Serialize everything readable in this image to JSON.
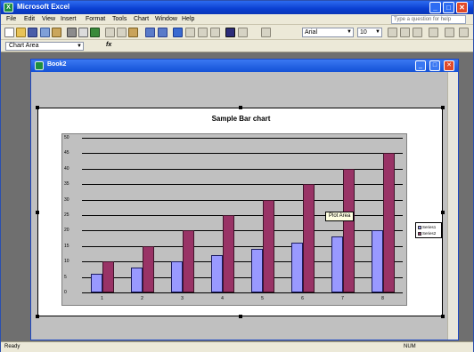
{
  "app": {
    "title": "Microsoft Excel",
    "buttons": {
      "minimize": "_",
      "maximize": "□",
      "close": "✕"
    }
  },
  "menubar": {
    "items": [
      "File",
      "Edit",
      "View",
      "Insert",
      "Format",
      "Tools",
      "Chart",
      "Window",
      "Help"
    ],
    "help_placeholder": "Type a question for help"
  },
  "toolbar": {
    "font": "Arial",
    "size": "10"
  },
  "formula": {
    "namebox": "Chart Area",
    "fx": "fx"
  },
  "workbook": {
    "title": "Book2"
  },
  "chart_data": {
    "type": "bar",
    "title": "Sample Bar chart",
    "categories": [
      "1",
      "2",
      "3",
      "4",
      "5",
      "6",
      "7",
      "8"
    ],
    "series": [
      {
        "name": "Series1",
        "values": [
          6,
          8,
          10,
          12,
          14,
          16,
          18,
          20
        ],
        "color": "#9999ff"
      },
      {
        "name": "Series2",
        "values": [
          10,
          15,
          20,
          25,
          30,
          35,
          40,
          45
        ],
        "color": "#993366"
      }
    ],
    "ylim": [
      0,
      50
    ],
    "yticks": [
      "0",
      "5",
      "10",
      "15",
      "20",
      "25",
      "30",
      "35",
      "40",
      "45",
      "50"
    ],
    "grid": true,
    "legend_position": "right"
  },
  "tooltip": "Plot Area",
  "status": {
    "left": "Ready",
    "right": "NUM"
  }
}
